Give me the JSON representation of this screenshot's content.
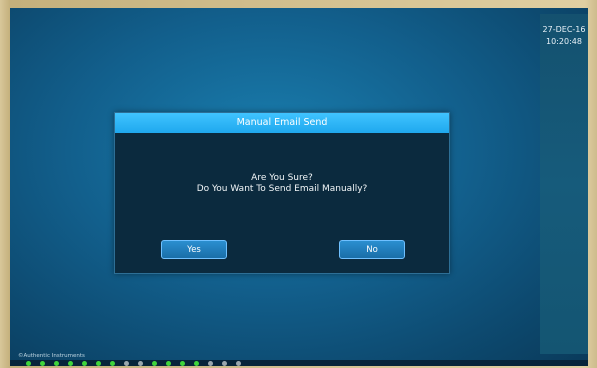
{
  "datetime": {
    "date": "27-DEC-16",
    "time": "10:20:48"
  },
  "dialog": {
    "title": "Manual Email Send",
    "line1": "Are You Sure?",
    "line2": "Do You Want To Send Email Manually?",
    "yes_label": "Yes",
    "no_label": "No"
  },
  "footer": {
    "copyright": "©Authentic Instruments"
  },
  "status_indicators": [
    {
      "name": "indicator-1",
      "color": "#3fd43a"
    },
    {
      "name": "indicator-2",
      "color": "#3fd43a"
    },
    {
      "name": "indicator-3",
      "color": "#3fd43a"
    },
    {
      "name": "indicator-4",
      "color": "#3fd43a"
    },
    {
      "name": "indicator-5",
      "color": "#3fd43a"
    },
    {
      "name": "indicator-6",
      "color": "#3fd43a"
    },
    {
      "name": "indicator-7",
      "color": "#3fd43a"
    },
    {
      "name": "indicator-8",
      "color": "#9aa6ad"
    },
    {
      "name": "indicator-9",
      "color": "#9aa6ad"
    },
    {
      "name": "indicator-10",
      "color": "#3fd43a"
    },
    {
      "name": "indicator-11",
      "color": "#3fd43a"
    },
    {
      "name": "indicator-12",
      "color": "#3fd43a"
    },
    {
      "name": "indicator-13",
      "color": "#3fd43a"
    },
    {
      "name": "indicator-14",
      "color": "#9aa6ad"
    },
    {
      "name": "indicator-15",
      "color": "#9aa6ad"
    },
    {
      "name": "indicator-16",
      "color": "#9aa6ad"
    }
  ]
}
